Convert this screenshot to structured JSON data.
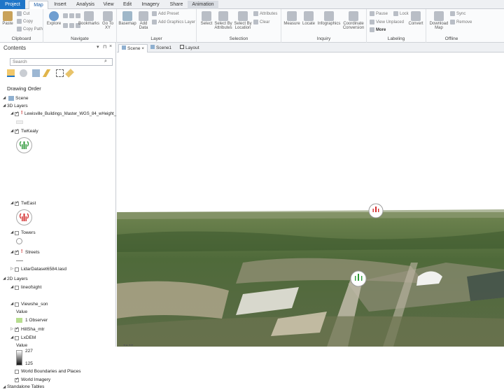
{
  "tabs": {
    "project": "Project",
    "map": "Map",
    "insert": "Insert",
    "analysis": "Analysis",
    "view": "View",
    "edit": "Edit",
    "imagery": "Imagery",
    "share": "Share",
    "animation": "Animation"
  },
  "ribbon": {
    "clipboard": {
      "title": "Clipboard",
      "paste": "Paste",
      "cut": "Cut",
      "copy": "Copy",
      "copy_path": "Copy Path"
    },
    "navigate": {
      "title": "Navigate",
      "explore": "Explore",
      "bookmarks": "Bookmarks",
      "goto_xy": "Go To XY"
    },
    "layer": {
      "title": "Layer",
      "basemap": "Basemap",
      "add_data": "Add Data",
      "add_preset": "Add Preset",
      "add_graphics": "Add Graphics Layer"
    },
    "selection": {
      "title": "Selection",
      "select": "Select",
      "by_attributes": "Select By Attributes",
      "by_location": "Select By Location",
      "attributes": "Attributes",
      "clear": "Clear"
    },
    "inquiry": {
      "title": "Inquiry",
      "measure": "Measure",
      "locate": "Locate",
      "infographics": "Infographics",
      "coord": "Coordinate Conversion"
    },
    "labeling": {
      "title": "Labeling",
      "pause": "Pause",
      "lock": "Lock",
      "view_unplaced": "View Unplaced",
      "more": "More",
      "convert": "Convert"
    },
    "offline": {
      "title": "Offline",
      "download": "Download Map",
      "sync": "Sync",
      "remove": "Remove"
    }
  },
  "contents": {
    "title": "Contents",
    "search_placeholder": "Search",
    "drawing_order": "Drawing Order",
    "scene": "Scene",
    "group_3d": "3D Layers",
    "layer_buildings": "Lewisville_Buildings_Master_WGS_84_wHeight_",
    "layer_twkealy": "TwKealy",
    "layer_tweast": "TwEast",
    "layer_towers": "Towers",
    "layer_streets": "Streets",
    "layer_lidar": "LidarDataset6584.lasd",
    "group_2d": "2D Layers",
    "layer_lineofsight": "lineofsight",
    "layer_viewshed": "Viewshe_son",
    "value_label": "Value",
    "observer_label": "1 Observer",
    "layer_hillsha": "HillSha_mtr",
    "layer_lxdem": "LxDEM",
    "value_label2": "Value",
    "dem_max": "227",
    "dem_min": "125",
    "layer_world_boundaries": "World Boundaries and Places",
    "layer_world_imagery": "World Imagery",
    "standalone": "Standalone Tables"
  },
  "views": {
    "scene_tab": "Scene",
    "scene1_tab": "Scene1",
    "layout_tab": "Layout"
  },
  "colors": {
    "project_blue": "#1f75c8",
    "tower_green": "#2e9a3a",
    "tower_red": "#d32f2f",
    "observer_green": "#b7dd8f"
  }
}
